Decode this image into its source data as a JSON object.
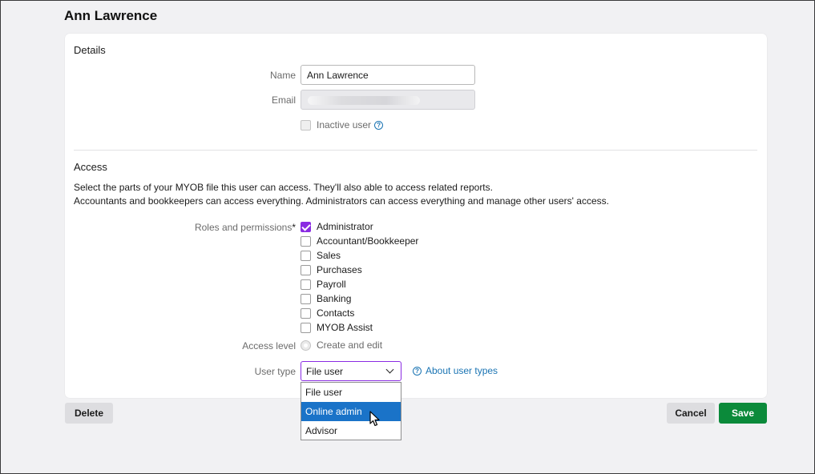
{
  "page": {
    "title": "Ann Lawrence"
  },
  "details": {
    "heading": "Details",
    "name_label": "Name",
    "name_value": "Ann Lawrence",
    "email_label": "Email",
    "email_value": "",
    "inactive_label": "Inactive user"
  },
  "access": {
    "heading": "Access",
    "desc_line1": "Select the parts of your MYOB file this user can access. They'll also able to access related reports.",
    "desc_line2": "Accountants and bookkeepers can access everything. Administrators can access everything and manage other users' access.",
    "roles_label": "Roles and permissions",
    "required_mark": "*",
    "roles": [
      {
        "label": "Administrator",
        "checked": true
      },
      {
        "label": "Accountant/Bookkeeper",
        "checked": false
      },
      {
        "label": "Sales",
        "checked": false
      },
      {
        "label": "Purchases",
        "checked": false
      },
      {
        "label": "Payroll",
        "checked": false
      },
      {
        "label": "Banking",
        "checked": false
      },
      {
        "label": "Contacts",
        "checked": false
      },
      {
        "label": "MYOB Assist",
        "checked": false
      }
    ],
    "access_level_label": "Access level",
    "access_level_value": "Create and edit",
    "user_type_label": "User type",
    "user_type_value": "File user",
    "about_link": "About user types",
    "user_type_options": [
      "File user",
      "Online admin",
      "Advisor"
    ],
    "highlighted_option": "Online admin"
  },
  "footer": {
    "delete_label": "Delete",
    "cancel_label": "Cancel",
    "save_label": "Save"
  },
  "colors": {
    "accent": "#8a2be2",
    "save": "#0b8a3a",
    "link": "#1a74b3",
    "highlight": "#1a73c8"
  },
  "icons": [
    "help-icon",
    "chevron-down-icon",
    "check-icon",
    "pointer-cursor-icon"
  ]
}
